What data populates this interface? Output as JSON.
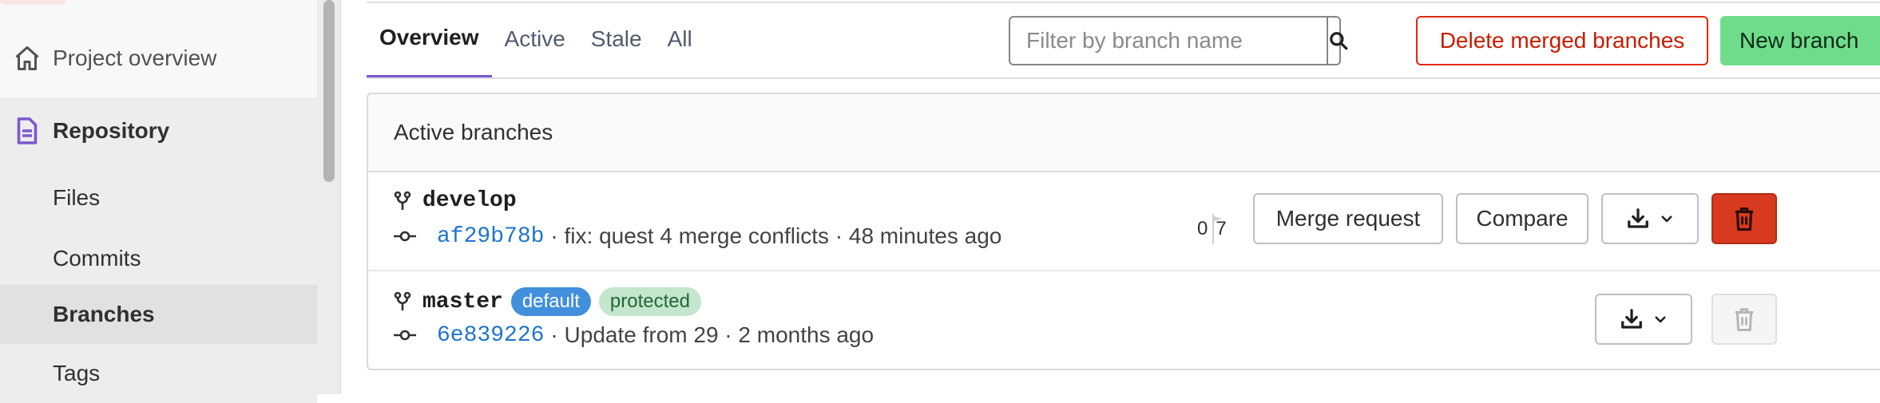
{
  "sidebar": {
    "project_overview": "Project overview",
    "repository": "Repository",
    "items": [
      {
        "label": "Files"
      },
      {
        "label": "Commits"
      },
      {
        "label": "Branches",
        "active": true
      },
      {
        "label": "Tags"
      }
    ]
  },
  "tabs": [
    {
      "label": "Overview",
      "active": true
    },
    {
      "label": "Active"
    },
    {
      "label": "Stale"
    },
    {
      "label": "All"
    }
  ],
  "filter": {
    "placeholder": "Filter by branch name",
    "value": ""
  },
  "toolbar": {
    "delete_merged_label": "Delete merged branches",
    "new_branch_label": "New branch"
  },
  "panel": {
    "title": "Active branches",
    "branches": [
      {
        "name": "develop",
        "sha": "af29b78b",
        "message": "· fix: quest 4 merge conflicts · 48 minutes ago",
        "behind": "0",
        "ahead": "7",
        "merge_request_label": "Merge request",
        "compare_label": "Compare"
      },
      {
        "name": "master",
        "default_badge": "default",
        "protected_badge": "protected",
        "sha": "6e839226",
        "message": "· Update from 29 · 2 months ago"
      }
    ]
  },
  "colors": {
    "accent_tab": "#7b58cf",
    "danger": "#dd2b0e",
    "success": "#6fdc8c",
    "link": "#1f75cb"
  }
}
